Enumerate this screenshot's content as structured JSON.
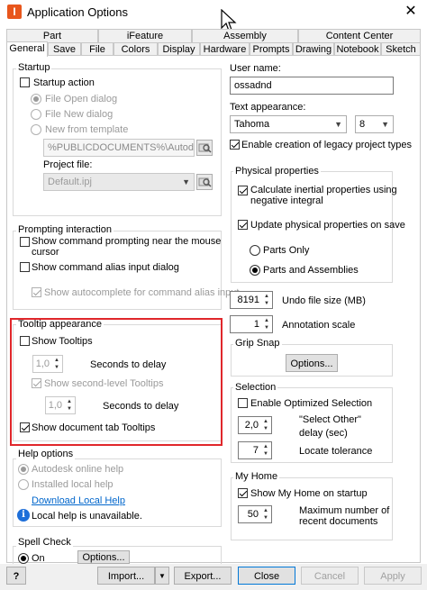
{
  "window": {
    "title": "Application Options",
    "app_icon_letter": "I",
    "close_glyph": "✕"
  },
  "tabs_top": [
    "Part",
    "iFeature",
    "Assembly",
    "Content Center"
  ],
  "tabs_bottom": [
    "General",
    "Save",
    "File",
    "Colors",
    "Display",
    "Hardware",
    "Prompts",
    "Drawing",
    "Notebook",
    "Sketch"
  ],
  "startup": {
    "group_label": "Startup",
    "startup_action": "Startup action",
    "file_open": "File Open dialog",
    "file_new": "File New dialog",
    "new_from_template": "New from template",
    "template_path": "%PUBLICDOCUMENTS%\\Autodesk\\Inv",
    "project_file_label": "Project file:",
    "project_file": "Default.ipj"
  },
  "prompting": {
    "group_label": "Prompting interaction",
    "show_prompting": "Show command prompting near the mouse",
    "show_prompting_2": "cursor",
    "show_alias": "Show command alias input dialog",
    "show_autocomplete": "Show autocomplete for command alias input"
  },
  "tooltip": {
    "group_label": "Tooltip appearance",
    "show_tooltips": "Show Tooltips",
    "delay1_value": "1,0",
    "delay1_label": "Seconds to delay",
    "show_second": "Show second-level Tooltips",
    "delay2_value": "1,0",
    "delay2_label": "Seconds to delay",
    "show_doc_tab": "Show document tab Tooltips"
  },
  "help": {
    "group_label": "Help options",
    "online": "Autodesk online help",
    "installed": "Installed local help",
    "download": "Download Local Help",
    "info": "Local help is unavailable."
  },
  "spell": {
    "group_label": "Spell Check",
    "on": "On",
    "options": "Options..."
  },
  "user": {
    "label": "User name:",
    "value": "ossadnd",
    "text_appearance_label": "Text appearance:",
    "font": "Tahoma",
    "font_size": "8",
    "legacy": "Enable creation of legacy project types"
  },
  "physical": {
    "group_label": "Physical properties",
    "calc_inertial": "Calculate inertial properties using",
    "calc_inertial_2": "negative integral",
    "update_on_save": "Update physical properties on save",
    "parts_only": "Parts Only",
    "parts_assemblies": "Parts and Assemblies"
  },
  "undo": {
    "value": "8191",
    "label": "Undo file size (MB)"
  },
  "annotation": {
    "value": "1",
    "label": "Annotation scale"
  },
  "grip": {
    "group_label": "Grip Snap",
    "options": "Options..."
  },
  "selection": {
    "group_label": "Selection",
    "optimized": "Enable Optimized Selection",
    "select_other_value": "2,0",
    "select_other_label_1": "\"Select Other\"",
    "select_other_label_2": "delay (sec)",
    "locate_value": "7",
    "locate_label": "Locate tolerance"
  },
  "myhome": {
    "group_label": "My Home",
    "show_on_startup": "Show My Home on startup",
    "max_value": "50",
    "max_label_1": "Maximum number of",
    "max_label_2": "recent documents"
  },
  "footer": {
    "help_glyph": "?",
    "import": "Import...",
    "export": "Export...",
    "close": "Close",
    "cancel": "Cancel",
    "apply": "Apply"
  }
}
